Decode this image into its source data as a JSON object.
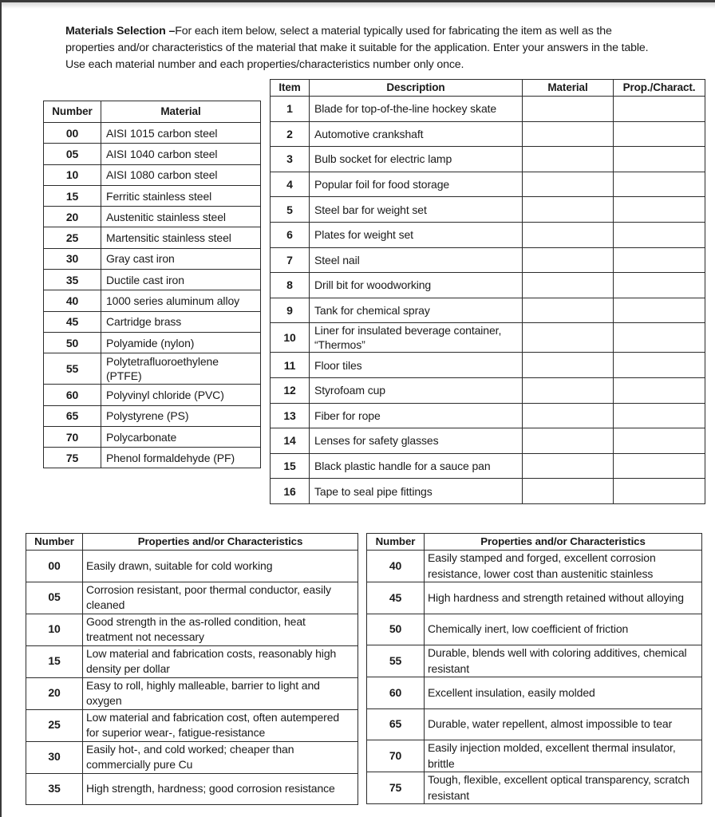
{
  "document": {
    "intro_title": "Materials Selection –",
    "intro_text": "For each item below, select a material typically used for fabricating the item as well as the properties and/or characteristics of the material that make it suitable for the application. Enter your answers in the table. Use each material number and each properties/characteristics number only once."
  },
  "items_table": {
    "headers": {
      "item": "Item",
      "description": "Description",
      "material": "Material",
      "prop": "Prop./Charact."
    },
    "rows": [
      {
        "item": "1",
        "description": "Blade for top-of-the-line hockey skate",
        "material": "",
        "prop": ""
      },
      {
        "item": "2",
        "description": "Automotive crankshaft",
        "material": "",
        "prop": ""
      },
      {
        "item": "3",
        "description": "Bulb socket for electric lamp",
        "material": "",
        "prop": ""
      },
      {
        "item": "4",
        "description": "Popular foil for food storage",
        "material": "",
        "prop": ""
      },
      {
        "item": "5",
        "description": "Steel bar for weight set",
        "material": "",
        "prop": ""
      },
      {
        "item": "6",
        "description": "Plates for weight set",
        "material": "",
        "prop": ""
      },
      {
        "item": "7",
        "description": "Steel nail",
        "material": "",
        "prop": ""
      },
      {
        "item": "8",
        "description": "Drill bit for woodworking",
        "material": "",
        "prop": ""
      },
      {
        "item": "9",
        "description": "Tank for chemical spray",
        "material": "",
        "prop": ""
      },
      {
        "item": "10",
        "description": "Liner for insulated beverage container, “Thermos”",
        "material": "",
        "prop": ""
      },
      {
        "item": "11",
        "description": "Floor tiles",
        "material": "",
        "prop": ""
      },
      {
        "item": "12",
        "description": "Styrofoam cup",
        "material": "",
        "prop": ""
      },
      {
        "item": "13",
        "description": "Fiber for rope",
        "material": "",
        "prop": ""
      },
      {
        "item": "14",
        "description": "Lenses for safety glasses",
        "material": "",
        "prop": ""
      },
      {
        "item": "15",
        "description": "Black plastic handle for a sauce pan",
        "material": "",
        "prop": ""
      },
      {
        "item": "16",
        "description": "Tape to seal pipe fittings",
        "material": "",
        "prop": ""
      }
    ]
  },
  "materials_table": {
    "headers": {
      "number": "Number",
      "material": "Material"
    },
    "rows": [
      {
        "number": "00",
        "material": "AISI 1015 carbon steel"
      },
      {
        "number": "05",
        "material": "AISI 1040 carbon steel"
      },
      {
        "number": "10",
        "material": "AISI 1080 carbon steel"
      },
      {
        "number": "15",
        "material": "Ferritic stainless steel"
      },
      {
        "number": "20",
        "material": "Austenitic stainless steel"
      },
      {
        "number": "25",
        "material": "Martensitic stainless steel"
      },
      {
        "number": "30",
        "material": "Gray cast iron"
      },
      {
        "number": "35",
        "material": "Ductile cast iron"
      },
      {
        "number": "40",
        "material": "1000 series aluminum alloy"
      },
      {
        "number": "45",
        "material": "Cartridge brass"
      },
      {
        "number": "50",
        "material": "Polyamide (nylon)"
      },
      {
        "number": "55",
        "material": "Polytetrafluoroethylene (PTFE)"
      },
      {
        "number": "60",
        "material": "Polyvinyl chloride (PVC)"
      },
      {
        "number": "65",
        "material": "Polystyrene (PS)"
      },
      {
        "number": "70",
        "material": "Polycarbonate"
      },
      {
        "number": "75",
        "material": "Phenol formaldehyde (PF)"
      }
    ]
  },
  "properties_left": {
    "headers": {
      "number": "Number",
      "props": "Properties and/or Characteristics"
    },
    "rows": [
      {
        "number": "00",
        "text": "Easily drawn, suitable for cold working"
      },
      {
        "number": "05",
        "text": "Corrosion resistant, poor thermal conductor, easily cleaned"
      },
      {
        "number": "10",
        "text": "Good strength in the as-rolled condition, heat treatment not necessary"
      },
      {
        "number": "15",
        "text": "Low material and fabrication costs, reasonably high density per dollar"
      },
      {
        "number": "20",
        "text": "Easy to roll, highly malleable, barrier to light and oxygen"
      },
      {
        "number": "25",
        "text": "Low material and fabrication cost, often autempered for superior wear-, fatigue-resistance"
      },
      {
        "number": "30",
        "text": "Easily hot-, and cold worked; cheaper than commercially pure Cu"
      },
      {
        "number": "35",
        "text": "High strength, hardness; good corrosion resistance"
      }
    ]
  },
  "properties_right": {
    "headers": {
      "number": "Number",
      "props": "Properties and/or Characteristics"
    },
    "rows": [
      {
        "number": "40",
        "text": "Easily stamped and forged, excellent corrosion resistance, lower cost than austenitic stainless"
      },
      {
        "number": "45",
        "text": "High hardness and strength retained without alloying"
      },
      {
        "number": "50",
        "text": "Chemically inert, low coefficient of friction"
      },
      {
        "number": "55",
        "text": "Durable, blends well with coloring additives, chemical resistant"
      },
      {
        "number": "60",
        "text": "Excellent insulation, easily molded"
      },
      {
        "number": "65",
        "text": "Durable, water repellent, almost impossible to tear"
      },
      {
        "number": "70",
        "text": "Easily injection molded, excellent thermal insulator, brittle"
      },
      {
        "number": "75",
        "text": "Tough, flexible, excellent optical transparency, scratch resistant"
      }
    ]
  }
}
